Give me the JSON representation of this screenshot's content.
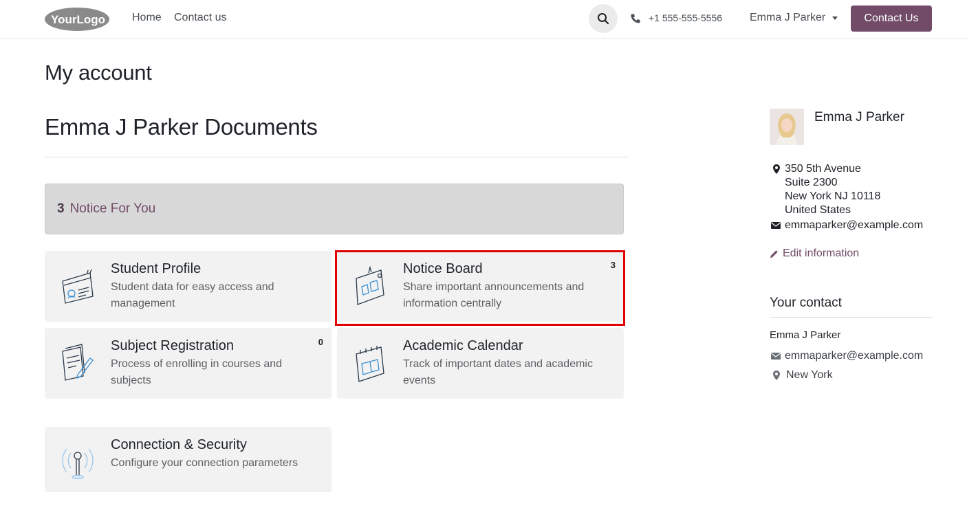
{
  "header": {
    "logo_text": "YourLogo",
    "nav": [
      "Home",
      "Contact us"
    ],
    "phone": "+1 555-555-5556",
    "user": "Emma J Parker",
    "cta": "Contact Us"
  },
  "page": {
    "title": "My account",
    "documents_title": "Emma J Parker Documents"
  },
  "notice": {
    "count": "3",
    "label": "Notice For You"
  },
  "cards": [
    {
      "title": "Student Profile",
      "desc": "Student data for easy access and management",
      "badge": "",
      "icon": "student-profile-icon"
    },
    {
      "title": "Notice Board",
      "desc": "Share important announcements and information centrally",
      "badge": "3",
      "icon": "notice-board-icon"
    },
    {
      "title": "Subject Registration",
      "desc": "Process of enrolling in courses and subjects",
      "badge": "0",
      "icon": "subject-registration-icon"
    },
    {
      "title": "Academic Calendar",
      "desc": "Track of important dates and academic events",
      "badge": "",
      "icon": "academic-calendar-icon"
    },
    {
      "title": "Connection & Security",
      "desc": "Configure your connection parameters",
      "badge": "",
      "icon": "connection-security-icon"
    }
  ],
  "sidebar": {
    "name": "Emma J Parker",
    "address": [
      "350 5th Avenue",
      "Suite 2300",
      "New York NJ 10118",
      "United States"
    ],
    "email": "emmaparker@example.com",
    "edit_label": "Edit information",
    "your_contact_title": "Your contact",
    "contact_name": "Emma J Parker",
    "contact_email": "emmaparker@example.com",
    "contact_city": "New York"
  },
  "colors": {
    "brand": "#714b67",
    "highlight": "#e00000"
  }
}
